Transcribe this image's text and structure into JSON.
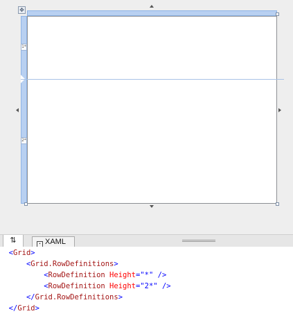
{
  "designer": {
    "row_markers": [
      {
        "label": "1*"
      },
      {
        "label": "2*"
      }
    ]
  },
  "tabs": {
    "swap_label": "⇅",
    "xaml_label": "XAML"
  },
  "code": {
    "lines": [
      {
        "indent": "  ",
        "open": "<",
        "tag": "Grid",
        "attr": "",
        "eq": "",
        "value": "",
        "close": ">"
      },
      {
        "indent": "      ",
        "open": "<",
        "tag": "Grid.RowDefinitions",
        "attr": "",
        "eq": "",
        "value": "",
        "close": ">"
      },
      {
        "indent": "          ",
        "open": "<",
        "tag": "RowDefinition",
        "attr": " Height",
        "eq": "=",
        "value": "\"*\"",
        "close": " />"
      },
      {
        "indent": "          ",
        "open": "<",
        "tag": "RowDefinition",
        "attr": " Height",
        "eq": "=",
        "value": "\"2*\"",
        "close": " />"
      },
      {
        "indent": "      ",
        "open": "</",
        "tag": "Grid.RowDefinitions",
        "attr": "",
        "eq": "",
        "value": "",
        "close": ">"
      },
      {
        "indent": "  ",
        "open": "</",
        "tag": "Grid",
        "attr": "",
        "eq": "",
        "value": "",
        "close": ">"
      }
    ]
  }
}
